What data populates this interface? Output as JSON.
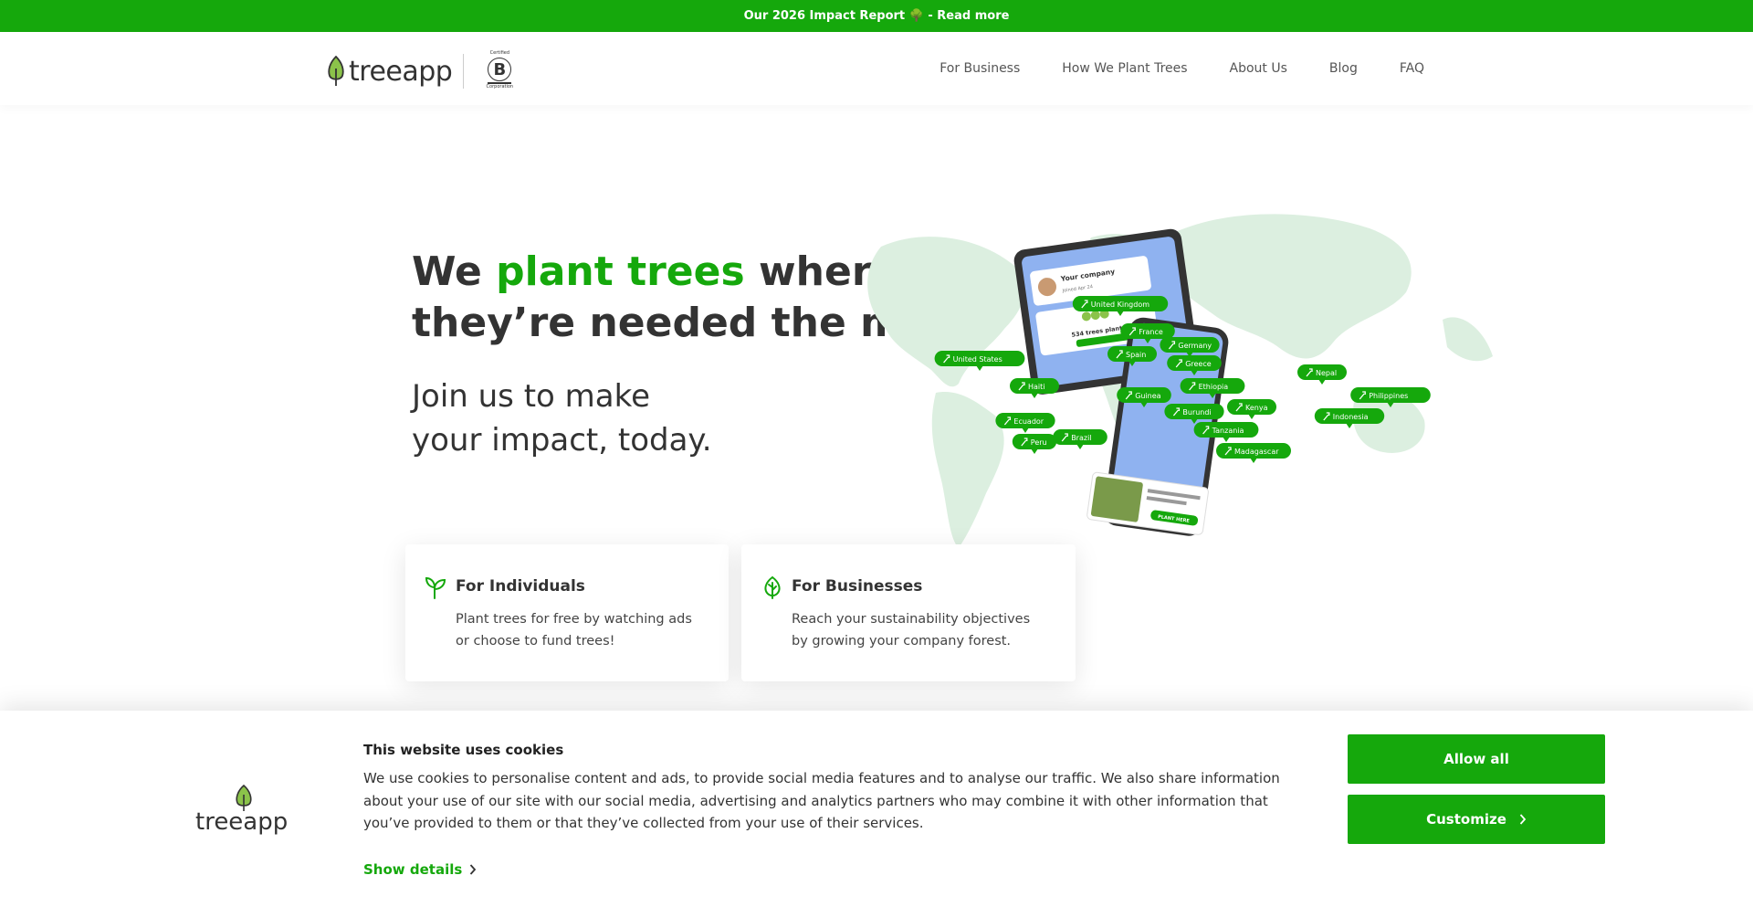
{
  "topbar": {
    "text": "Our 2026 Impact Report 🌳 - Read more"
  },
  "header": {
    "logo_text": "treeapp",
    "bcorp": {
      "top": "Certified",
      "letter": "B",
      "bottom": "Corporation"
    },
    "nav": [
      "For Business",
      "How We Plant Trees",
      "About Us",
      "Blog",
      "FAQ"
    ]
  },
  "hero": {
    "headline_1": "We ",
    "headline_green": "plant trees",
    "headline_2": " where",
    "headline_3": "they’re needed the most",
    "sub_1": "Join us to make",
    "sub_2": "your impact, today."
  },
  "cards": [
    {
      "title": "For Individuals",
      "line1": "Plant trees for free by watching ads",
      "line2": "or choose to fund trees!"
    },
    {
      "title": "For Businesses",
      "line1": "Reach your sustainability objectives",
      "line2": "by growing your company forest."
    }
  ],
  "map": {
    "pins": [
      "United Kingdom",
      "France",
      "Germany",
      "Spain",
      "Greece",
      "United States",
      "Haiti",
      "Guinea",
      "Ethiopia",
      "Nepal",
      "Philippines",
      "Burundi",
      "Kenya",
      "Indonesia",
      "Ecuador",
      "Tanzania",
      "Peru",
      "Brazil",
      "Madagascar"
    ],
    "tablet": {
      "company": "Your company",
      "joined": "Joined Apr 24",
      "trees": "534 trees planted"
    },
    "phone": {
      "button": "PLANT HERE"
    }
  },
  "cookie": {
    "logo_text": "treeapp",
    "title": "This website uses cookies",
    "text": "We use cookies to personalise content and ads, to provide social media features and to analyse our traffic. We also share information about your use of our site with our social media, advertising and analytics partners who may combine it with other information that you’ve provided to them or that they’ve collected from your use of their services.",
    "details": "Show details",
    "allow": "Allow all",
    "customize": "Customize"
  },
  "colors": {
    "brand_green": "#15a80c"
  }
}
